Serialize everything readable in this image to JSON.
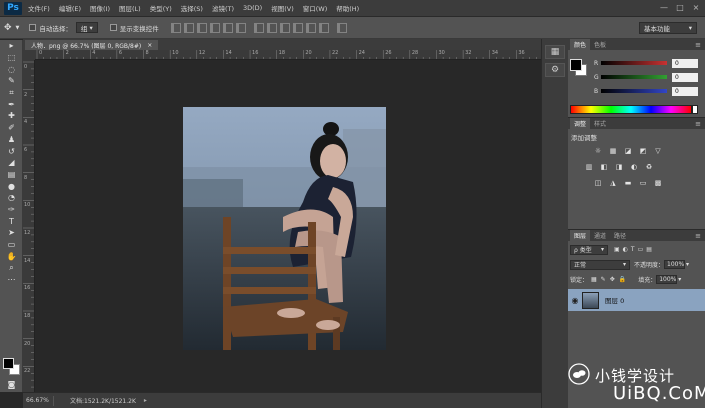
{
  "menubar": {
    "logo": "Ps",
    "items": [
      "文件(F)",
      "编辑(E)",
      "图像(I)",
      "图层(L)",
      "类型(Y)",
      "选择(S)",
      "滤镜(T)",
      "3D(D)",
      "视图(V)",
      "窗口(W)",
      "帮助(H)"
    ],
    "window_controls": [
      "—",
      "□",
      "×"
    ]
  },
  "options_bar": {
    "auto_select_label": "自动选择：",
    "auto_select_value": "组",
    "show_transform_label": "显示变换控件",
    "workspace": "基本功能"
  },
  "document": {
    "tab_title": "人物．png @ 66.7% (图层 0, RGB/8#)",
    "tab_close": "×",
    "ruler_h_ticks": [
      "0",
      "2",
      "4",
      "6",
      "8",
      "10",
      "12",
      "14",
      "16",
      "18",
      "20",
      "22",
      "24",
      "26",
      "28",
      "30",
      "32",
      "34",
      "36"
    ],
    "ruler_v_ticks": [
      "0",
      "2",
      "4",
      "6",
      "8",
      "10",
      "12",
      "14",
      "16",
      "18",
      "20",
      "22"
    ]
  },
  "statusbar": {
    "zoom": "66.67%",
    "doc_info": "文档:1521.2K/1521.2K"
  },
  "color_panel": {
    "tabs": [
      "颜色",
      "色板"
    ],
    "sliders": [
      {
        "label": "R",
        "value": "0",
        "color": "#c83232"
      },
      {
        "label": "G",
        "value": "0",
        "color": "#32a032"
      },
      {
        "label": "B",
        "value": "0",
        "color": "#3246c8"
      }
    ]
  },
  "adjustments_panel": {
    "tabs": [
      "调整",
      "样式"
    ],
    "title": "添加调整",
    "row1": [
      "☼",
      "▦",
      "◪",
      "◩",
      "▽"
    ],
    "row2": [
      "▥",
      "◧",
      "◨",
      "◐",
      "♻"
    ],
    "row3": [
      "◫",
      "◮",
      "▬",
      "▭",
      "▩"
    ]
  },
  "layers_panel": {
    "tabs": [
      "图层",
      "通道",
      "路径"
    ],
    "filter_label": "ρ 类型",
    "blend_mode": "正常",
    "opacity_label": "不透明度：",
    "opacity_value": "100%",
    "lock_label": "锁定：",
    "fill_label": "填充：",
    "fill_value": "100%",
    "layer_name": "图层 0"
  },
  "watermark": {
    "text": "小钱学设计",
    "brand": "UiBQ.CoM"
  }
}
